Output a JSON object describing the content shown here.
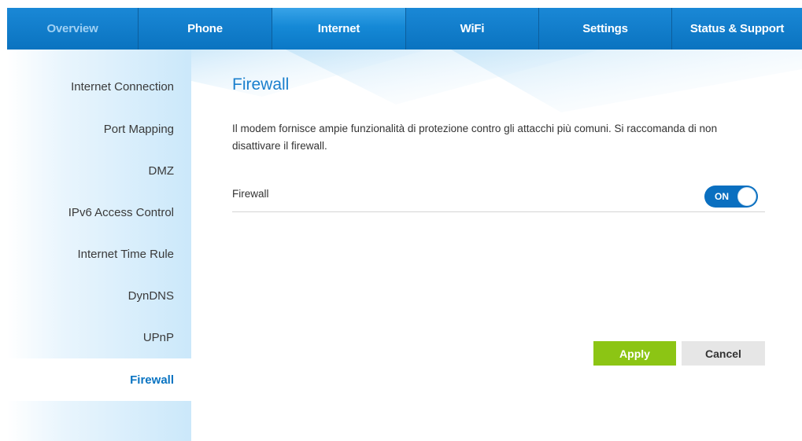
{
  "nav": {
    "tabs": [
      {
        "label": "Overview"
      },
      {
        "label": "Phone"
      },
      {
        "label": "Internet"
      },
      {
        "label": "WiFi"
      },
      {
        "label": "Settings"
      },
      {
        "label": "Status & Support"
      }
    ],
    "active_tab": "Internet"
  },
  "sidebar": {
    "items": [
      {
        "label": "Internet Connection"
      },
      {
        "label": "Port Mapping"
      },
      {
        "label": "DMZ"
      },
      {
        "label": "IPv6 Access Control"
      },
      {
        "label": "Internet Time Rule"
      },
      {
        "label": "DynDNS"
      },
      {
        "label": "UPnP"
      },
      {
        "label": "Firewall"
      }
    ],
    "active_item": "Firewall"
  },
  "main": {
    "title": "Firewall",
    "description": "Il modem fornisce ampie funzionalità di protezione contro gli attacchi più comuni. Si raccomanda di non disattivare il firewall.",
    "firewall_row": {
      "label": "Firewall",
      "toggle_text": "ON",
      "enabled": true
    },
    "apply_label": "Apply",
    "cancel_label": "Cancel"
  },
  "colors": {
    "nav_blue": "#0a74c2",
    "title_blue": "#1a7fcd",
    "apply_green": "#8cc514",
    "cancel_gray": "#e6e6e6",
    "toggle_blue": "#0a6fc0"
  }
}
